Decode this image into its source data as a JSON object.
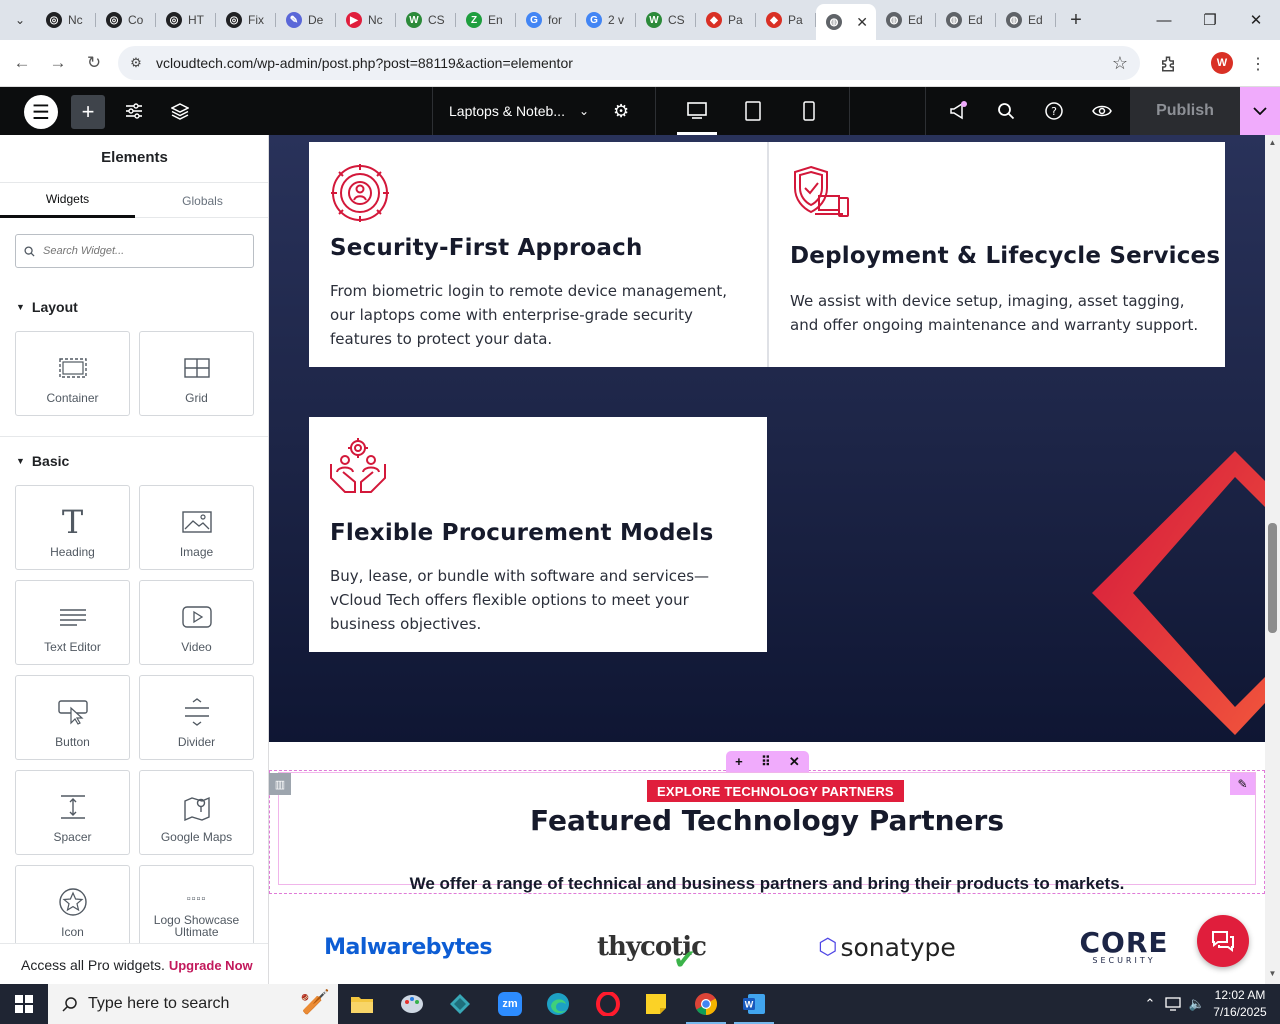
{
  "browser": {
    "tabs": [
      {
        "label": "Nc",
        "fav_color": "#202124",
        "fav_glyph": "◎"
      },
      {
        "label": "Co",
        "fav_color": "#202124",
        "fav_glyph": "◎"
      },
      {
        "label": "HT",
        "fav_color": "#202124",
        "fav_glyph": "◎"
      },
      {
        "label": "Fix",
        "fav_color": "#202124",
        "fav_glyph": "◎"
      },
      {
        "label": "De",
        "fav_color": "#5a67d8",
        "fav_glyph": "✎"
      },
      {
        "label": "Nc",
        "fav_color": "#e01e3c",
        "fav_glyph": "▶"
      },
      {
        "label": "CS",
        "fav_color": "#2c8a3a",
        "fav_glyph": "W"
      },
      {
        "label": "En",
        "fav_color": "#1e9e3e",
        "fav_glyph": "Z"
      },
      {
        "label": "for",
        "fav_color": "#4285f4",
        "fav_glyph": "G"
      },
      {
        "label": "2 v",
        "fav_color": "#4285f4",
        "fav_glyph": "G"
      },
      {
        "label": "CS",
        "fav_color": "#2c8a3a",
        "fav_glyph": "W"
      },
      {
        "label": "Pa",
        "fav_color": "#d93025",
        "fav_glyph": "◆"
      },
      {
        "label": "Pa",
        "fav_color": "#d93025",
        "fav_glyph": "◆"
      },
      {
        "label": "",
        "fav_color": "#5f6368",
        "fav_glyph": "◍",
        "active": true
      },
      {
        "label": "Ed",
        "fav_color": "#5f6368",
        "fav_glyph": "◍"
      },
      {
        "label": "Ed",
        "fav_color": "#5f6368",
        "fav_glyph": "◍"
      },
      {
        "label": "Ed",
        "fav_color": "#5f6368",
        "fav_glyph": "◍"
      }
    ],
    "url": "vcloudtech.com/wp-admin/post.php?post=88119&action=elementor",
    "profile_initial": "W"
  },
  "editor": {
    "page_name": "Laptops & Noteb...",
    "publish_label": "Publish"
  },
  "panel": {
    "title": "Elements",
    "tabs": [
      "Widgets",
      "Globals"
    ],
    "search_placeholder": "Search Widget...",
    "layout_title": "Layout",
    "basic_title": "Basic",
    "layout_widgets": [
      "Container",
      "Grid"
    ],
    "basic_widgets": [
      "Heading",
      "Image",
      "Text Editor",
      "Video",
      "Button",
      "Divider",
      "Spacer",
      "Google Maps",
      "Icon",
      "Logo Showcase Ultimate"
    ],
    "promo_text": "Access all Pro widgets.",
    "promo_link": "Upgrade Now"
  },
  "canvas": {
    "cards": [
      {
        "title": "Security-First Approach",
        "body": "From biometric login to remote device management, our laptops come with enterprise-grade security features to protect your data."
      },
      {
        "title": "Deployment & Lifecycle Services",
        "body": "We assist with device setup, imaging, asset tagging, and offer ongoing maintenance and warranty support."
      },
      {
        "title": "Flexible Procurement Models",
        "body": "Buy, lease, or bundle with software and services—vCloud Tech offers flexible options to meet your business objectives."
      }
    ],
    "partners": {
      "eyebrow": "EXPLORE TECHNOLOGY PARTNERS",
      "title": "Featured Technology Partners",
      "subtitle": "We offer a range of technical and business partners and bring their products to markets.",
      "logos": [
        "Malwarebytes",
        "thycotic",
        "sonatype",
        "CORE",
        "SECURITY"
      ]
    },
    "accent_color": "#e01e3c",
    "navy_color": "#1d2547"
  },
  "taskbar": {
    "search_placeholder": "Type here to search",
    "time": "12:02 AM",
    "date": "7/16/2025"
  }
}
